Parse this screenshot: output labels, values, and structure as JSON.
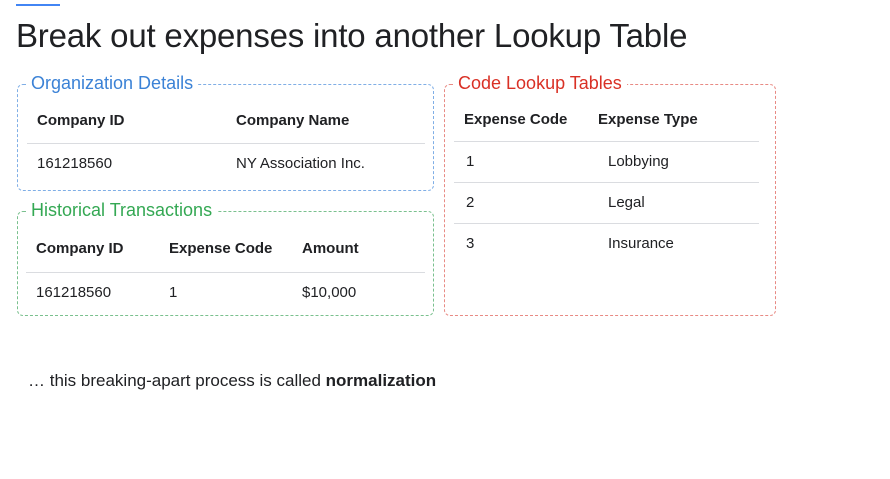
{
  "slide": {
    "title": "Break out expenses into another Lookup Table",
    "accent_color": "#4285f4"
  },
  "org_details": {
    "label": "Organization Details",
    "color": "#3b82d6",
    "headers": [
      "Company ID",
      "Company Name"
    ],
    "rows": [
      [
        "161218560",
        "NY Association Inc."
      ]
    ]
  },
  "transactions": {
    "label": "Historical Transactions",
    "color": "#34a853",
    "headers": [
      "Company ID",
      "Expense Code",
      "Amount"
    ],
    "rows": [
      [
        "161218560",
        "1",
        "$10,000"
      ]
    ]
  },
  "lookup": {
    "label": "Code Lookup Tables",
    "color": "#d93025",
    "headers": [
      "Expense Code",
      "Expense Type"
    ],
    "rows": [
      [
        "1",
        "Lobbying"
      ],
      [
        "2",
        "Legal"
      ],
      [
        "3",
        "Insurance"
      ]
    ]
  },
  "footnote": {
    "prefix": "… this breaking-apart process is called ",
    "emphasis": "normalization"
  }
}
